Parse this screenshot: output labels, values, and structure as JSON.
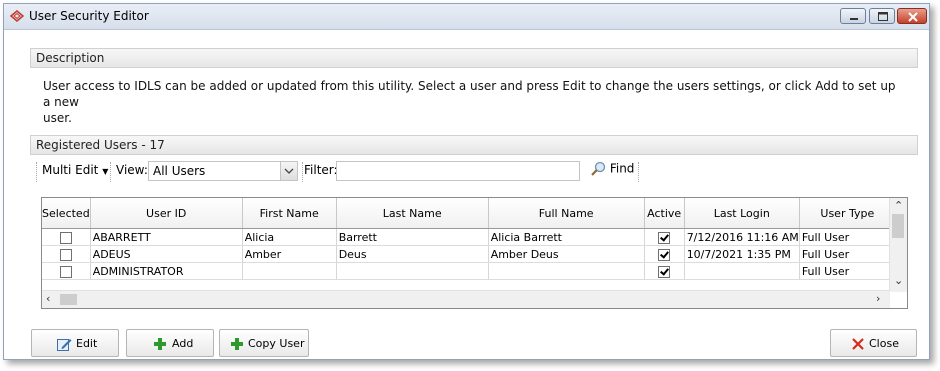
{
  "window": {
    "title": "User Security Editor"
  },
  "description": {
    "header": "Description",
    "line1": "User access to IDLS can be added or updated from this utility.  Select a user and press Edit to change the users settings, or click Add to set up a new",
    "line2": "user."
  },
  "registered": {
    "header": "Registered Users - 17"
  },
  "toolbar": {
    "multi_edit_label": "Multi Edit",
    "view_label": "View:",
    "view_value": "All Users",
    "filter_label": "Filter:",
    "filter_value": "",
    "find_label": "Find"
  },
  "table": {
    "columns": [
      "Selected",
      "User ID",
      "First Name",
      "Last Name",
      "Full Name",
      "Active",
      "Last Login",
      "User Type"
    ],
    "rows": [
      {
        "selected": false,
        "user_id": "ABARRETT",
        "first_name": "Alicia",
        "last_name": "Barrett",
        "full_name": "Alicia Barrett",
        "active": true,
        "last_login": "7/12/2016 11:16 AM",
        "user_type": "Full User"
      },
      {
        "selected": false,
        "user_id": "ADEUS",
        "first_name": "Amber",
        "last_name": "Deus",
        "full_name": "Amber Deus",
        "active": true,
        "last_login": "10/7/2021 1:35 PM",
        "user_type": "Full User"
      },
      {
        "selected": false,
        "user_id": "ADMINISTRATOR",
        "first_name": "",
        "last_name": "",
        "full_name": "",
        "active": true,
        "last_login": "",
        "user_type": "Full User"
      }
    ]
  },
  "buttons": {
    "edit": "Edit",
    "add": "Add",
    "copy_user": "Copy User",
    "close": "Close"
  },
  "colors": {
    "add_icon_green": "#2e9a2e",
    "close_icon_red": "#d42a1a",
    "titlebar_close_red": "#c4402c"
  }
}
